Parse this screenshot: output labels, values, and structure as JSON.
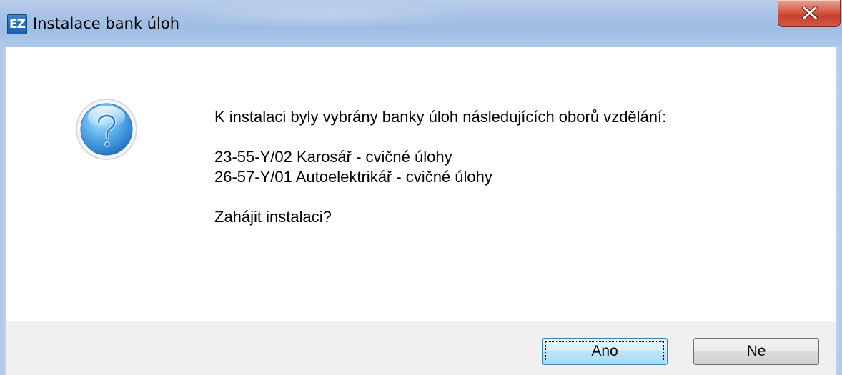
{
  "window": {
    "title": "Instalace bank úloh",
    "app_icon_text": "EZ",
    "close_icon": "close-icon"
  },
  "dialog": {
    "icon": "question-icon",
    "intro": "K instalaci byly vybrány banky úloh následujících oborů vzdělání:",
    "items": [
      "23-55-Y/02 Karosář - cvičné úlohy",
      "26-57-Y/01 Autoelektrikář - cvičné úlohy"
    ],
    "question": "Zahájit instalaci?"
  },
  "buttons": {
    "yes_label": "Ano",
    "no_label": "Ne"
  },
  "colors": {
    "titlebar": "#a9c3e6",
    "close_button": "#c7402a",
    "footer": "#f0f0f0",
    "default_button_border": "#3c7fb1"
  }
}
